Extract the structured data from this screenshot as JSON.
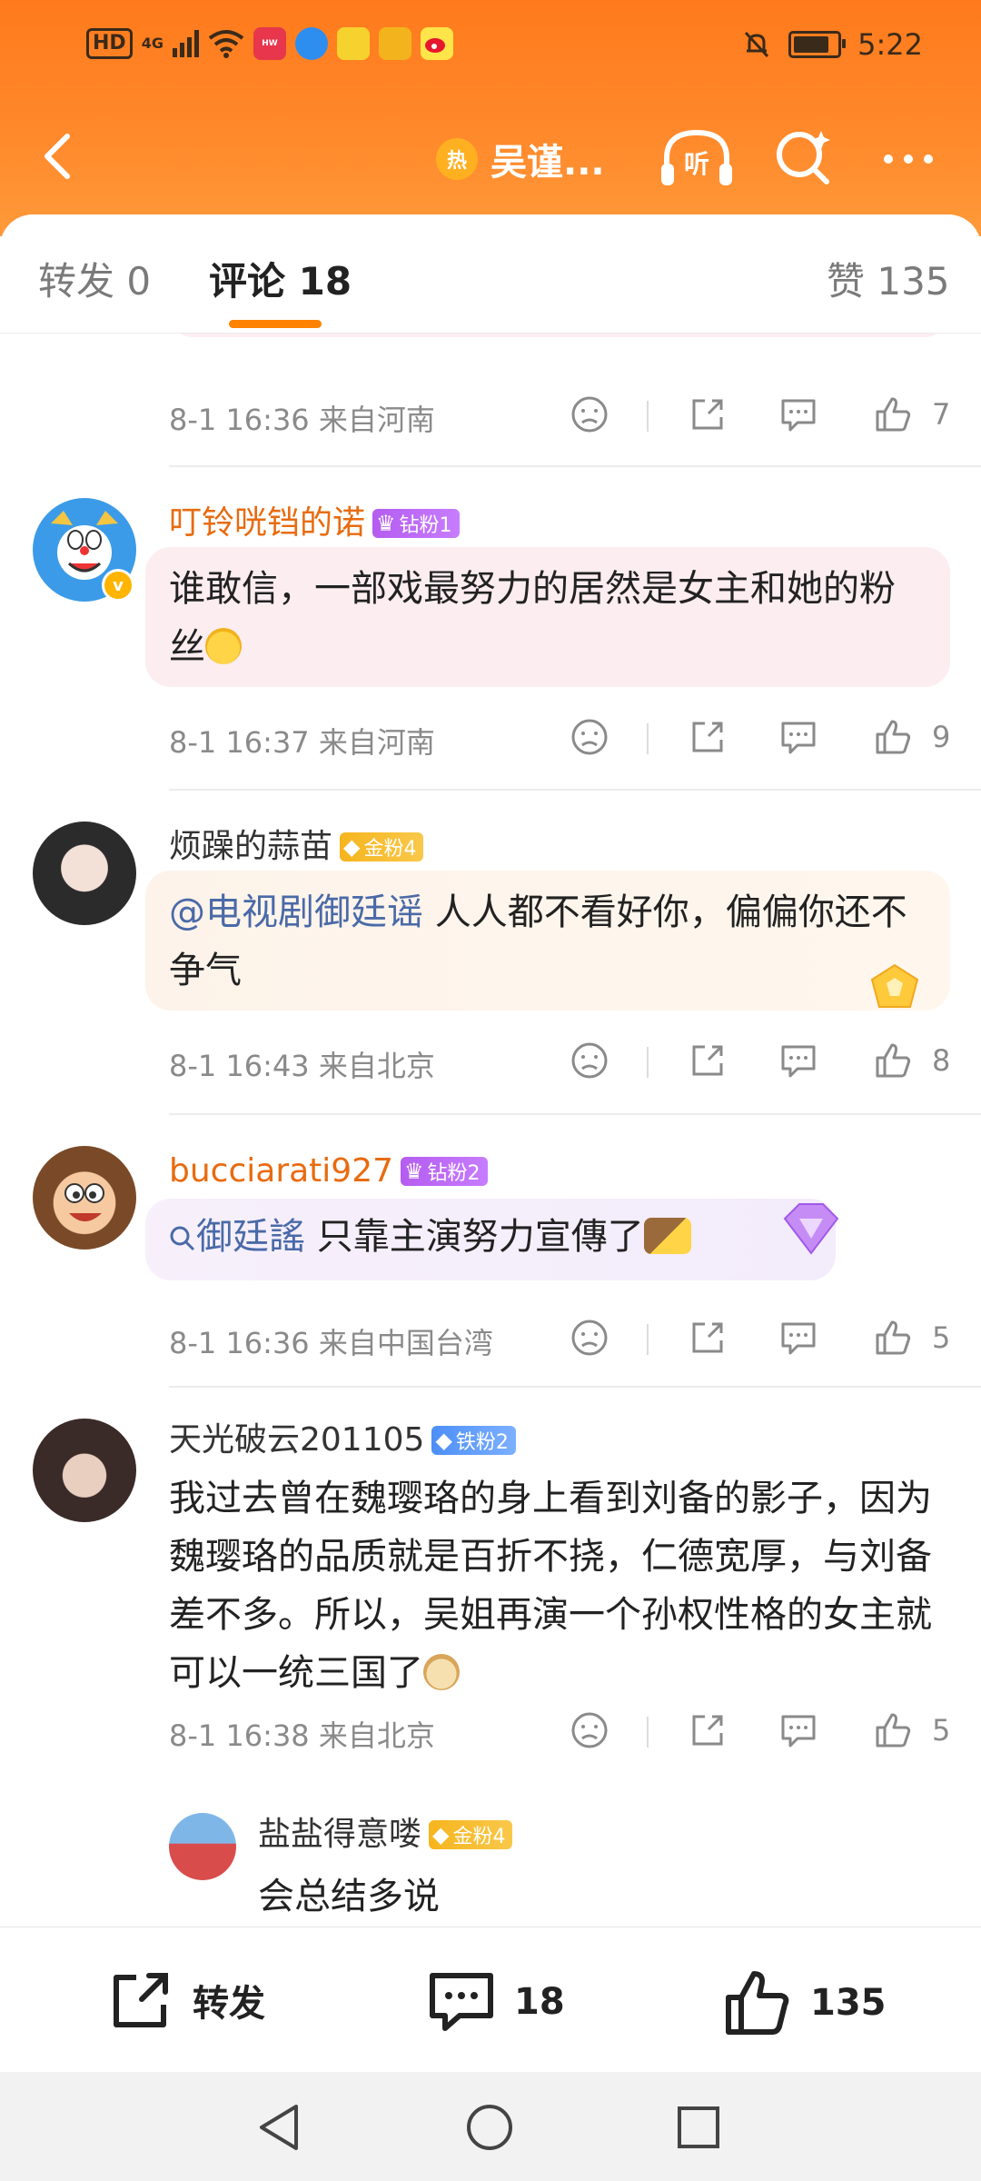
{
  "status_bar": {
    "hd": "HD",
    "network": "4G",
    "time": "5:22",
    "icons": [
      "signal-icon",
      "wifi-icon",
      "huawei-app-icon",
      "browser-app-icon",
      "pikachu-app-icon",
      "qq-app-icon",
      "weibo-app-icon",
      "mute-icon",
      "battery-icon"
    ]
  },
  "header": {
    "title": "吴谨...",
    "hot_badge": "热",
    "listen_label": "听",
    "colors": {
      "gradient_top": "#ff7a1c",
      "gradient_bottom": "#ff9a3a"
    }
  },
  "tabs": [
    {
      "label": "转发 0"
    },
    {
      "label": "评论 18"
    },
    {
      "label": "赞 135"
    }
  ],
  "accent_color": "#ff8200",
  "first_meta": {
    "time": "8-1 16:36",
    "location": "来自河南",
    "likes": "7"
  },
  "comments": [
    {
      "username": "叮铃咣铛的诺",
      "badge": "钻粉1",
      "text": "谁敢信，一部戏最努力的居然是女主和她的粉丝",
      "time": "8-1 16:37",
      "location": "来自河南",
      "likes": "9"
    },
    {
      "username": "烦躁的蒜苗",
      "badge": "金粉4",
      "mention": "@电视剧御廷谣",
      "text": " 人人都不看好你，偏偏你还不争气",
      "time": "8-1 16:43",
      "location": "来自北京",
      "likes": "8"
    },
    {
      "username": "bucciarati927",
      "badge": "钻粉2",
      "topic": "御廷謠",
      "text": " 只靠主演努力宣傳了",
      "time": "8-1 16:36",
      "location": "来自中国台湾",
      "likes": "5"
    },
    {
      "username": "天光破云201105",
      "badge": "铁粉2",
      "text": "我过去曾在魏璎珞的身上看到刘备的影子，因为魏璎珞的品质就是百折不挠，仁德宽厚，与刘备差不多。所以，吴姐再演一个孙权性格的女主就可以一统三国了",
      "time": "8-1 16:38",
      "location": "来自北京",
      "likes": "5",
      "reply": {
        "username": "盐盐得意喽",
        "badge": "金粉4",
        "text": "会总结多说"
      }
    }
  ],
  "action_bar": {
    "repost_label": "转发",
    "comment_count": "18",
    "like_count": "135"
  }
}
